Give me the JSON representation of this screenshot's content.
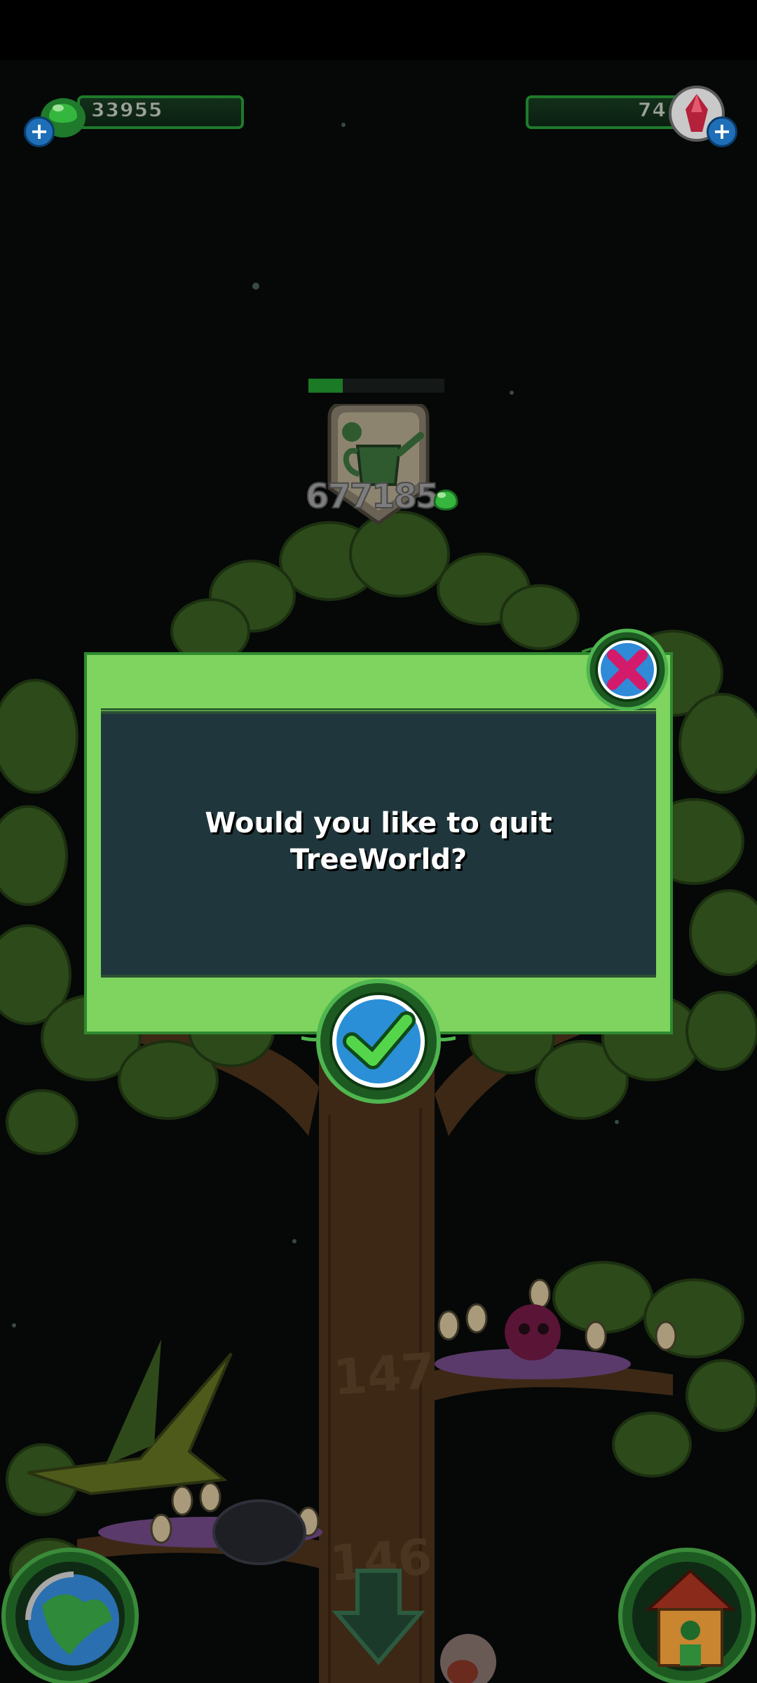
{
  "hud": {
    "resin_amount": "33955",
    "gem_amount": "74"
  },
  "upgrade": {
    "progress_fraction": 0.25,
    "cost": "677185"
  },
  "dialog": {
    "message_line1": "Would you like to quit",
    "message_line2": "TreeWorld?"
  },
  "tree": {
    "branch_level_upper": "147",
    "branch_level_lower": "146"
  },
  "icons": {
    "resin": "green-resin-drop-icon",
    "gem": "red-crystal-icon",
    "plus": "plus-icon",
    "watering_can": "watering-can-icon",
    "close": "close-x-icon",
    "confirm": "checkmark-icon",
    "world": "globe-icon",
    "down": "down-arrow-icon",
    "home": "birdhouse-icon"
  },
  "colors": {
    "dialog_green": "#7fd35f",
    "dialog_panel": "#1f373c",
    "leaf": "#2f4f1c",
    "trunk": "#3e2a17"
  }
}
